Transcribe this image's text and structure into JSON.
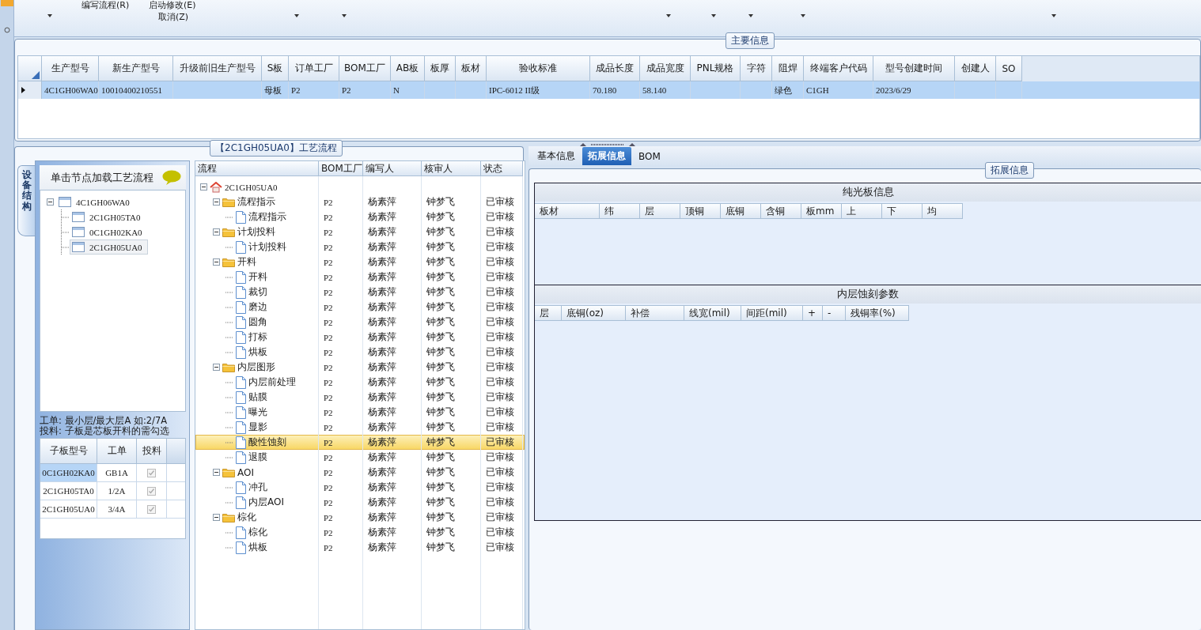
{
  "ribbon": {
    "commands": [
      {
        "label": "编写流程(R)"
      },
      {
        "label": "启动修改(E)"
      },
      {
        "label": "取消(Z)"
      }
    ]
  },
  "main_info": {
    "title": "主要信息",
    "columns": [
      "生产型号",
      "新生产型号",
      "升级前旧生产型号",
      "S板",
      "订单工厂",
      "BOM工厂",
      "AB板",
      "板厚",
      "板材",
      "验收标准",
      "成品长度",
      "成品宽度",
      "PNL规格",
      "字符",
      "阻焊",
      "终端客户代码",
      "型号创建时间",
      "创建人",
      "SO"
    ],
    "rows": [
      {
        "selected": true,
        "cells": [
          "4C1GH06WA0",
          "10010400210551",
          null,
          "母板",
          "P2",
          "P2",
          "N",
          null,
          null,
          "IPC-6012 II级",
          "70.180",
          "58.140",
          null,
          null,
          "绿色",
          "C1GH",
          "2023/6/29",
          null,
          null
        ]
      }
    ]
  },
  "flow_group": {
    "title": "【2C1GH05UA0】工艺流程",
    "side_tab": {
      "label": "设备结构",
      "selected": true
    },
    "structure": {
      "hint": "单击节点加载工艺流程",
      "tree": [
        {
          "label": "4C1GH06WA0",
          "expanded": true,
          "selected": false,
          "children": [
            {
              "label": "2C1GH05TA0",
              "selected": false
            },
            {
              "label": "0C1GH02KA0",
              "selected": false
            },
            {
              "label": "2C1GH05UA0",
              "selected": true
            }
          ]
        }
      ],
      "notes": [
        "工单: 最小层/最大层A 如:2/7A",
        "投料: 子板是芯板开料的需勾选"
      ],
      "sub_boards": {
        "columns": [
          "子板型号",
          "工单",
          "投料"
        ],
        "rows": [
          {
            "model": "0C1GH02KA0",
            "order": "GB1A",
            "feed": true,
            "selected": true
          },
          {
            "model": "2C1GH05TA0",
            "order": "1/2A",
            "feed": true,
            "selected": false
          },
          {
            "model": "2C1GH05UA0",
            "order": "3/4A",
            "feed": true,
            "selected": false
          }
        ]
      }
    },
    "flow": {
      "columns": [
        "流程",
        "BOM工厂",
        "编写人",
        "核审人",
        "状态"
      ],
      "tree": [
        {
          "kind": "root",
          "label": "2C1GH05UA0",
          "expanded": true,
          "selected": false,
          "children": [
            {
              "kind": "folder",
              "label": "流程指示",
              "bom": "P2",
              "writer": "杨素萍",
              "reviewer": "钟梦飞",
              "status": "已审核",
              "expanded": true,
              "selected": false,
              "children": [
                {
                  "kind": "doc",
                  "label": "流程指示",
                  "bom": "P2",
                  "writer": "杨素萍",
                  "reviewer": "钟梦飞",
                  "status": "已审核",
                  "selected": false
                }
              ]
            },
            {
              "kind": "folder",
              "label": "计划投料",
              "bom": "P2",
              "writer": "杨素萍",
              "reviewer": "钟梦飞",
              "status": "已审核",
              "expanded": true,
              "selected": false,
              "children": [
                {
                  "kind": "doc",
                  "label": "计划投料",
                  "bom": "P2",
                  "writer": "杨素萍",
                  "reviewer": "钟梦飞",
                  "status": "已审核",
                  "selected": false
                }
              ]
            },
            {
              "kind": "folder",
              "label": "开料",
              "bom": "P2",
              "writer": "杨素萍",
              "reviewer": "钟梦飞",
              "status": "已审核",
              "expanded": true,
              "selected": false,
              "children": [
                {
                  "kind": "doc",
                  "label": "开料",
                  "bom": "P2",
                  "writer": "杨素萍",
                  "reviewer": "钟梦飞",
                  "status": "已审核",
                  "selected": false
                },
                {
                  "kind": "doc",
                  "label": "裁切",
                  "bom": "P2",
                  "writer": "杨素萍",
                  "reviewer": "钟梦飞",
                  "status": "已审核",
                  "selected": false
                },
                {
                  "kind": "doc",
                  "label": "磨边",
                  "bom": "P2",
                  "writer": "杨素萍",
                  "reviewer": "钟梦飞",
                  "status": "已审核",
                  "selected": false
                },
                {
                  "kind": "doc",
                  "label": "圆角",
                  "bom": "P2",
                  "writer": "杨素萍",
                  "reviewer": "钟梦飞",
                  "status": "已审核",
                  "selected": false
                },
                {
                  "kind": "doc",
                  "label": "打标",
                  "bom": "P2",
                  "writer": "杨素萍",
                  "reviewer": "钟梦飞",
                  "status": "已审核",
                  "selected": false
                },
                {
                  "kind": "doc",
                  "label": "烘板",
                  "bom": "P2",
                  "writer": "杨素萍",
                  "reviewer": "钟梦飞",
                  "status": "已审核",
                  "selected": false
                }
              ]
            },
            {
              "kind": "folder",
              "label": "内层图形",
              "bom": "P2",
              "writer": "杨素萍",
              "reviewer": "钟梦飞",
              "status": "已审核",
              "expanded": true,
              "selected": false,
              "children": [
                {
                  "kind": "doc",
                  "label": "内层前处理",
                  "bom": "P2",
                  "writer": "杨素萍",
                  "reviewer": "钟梦飞",
                  "status": "已审核",
                  "selected": false
                },
                {
                  "kind": "doc",
                  "label": "贴膜",
                  "bom": "P2",
                  "writer": "杨素萍",
                  "reviewer": "钟梦飞",
                  "status": "已审核",
                  "selected": false
                },
                {
                  "kind": "doc",
                  "label": "曝光",
                  "bom": "P2",
                  "writer": "杨素萍",
                  "reviewer": "钟梦飞",
                  "status": "已审核",
                  "selected": false
                },
                {
                  "kind": "doc",
                  "label": "显影",
                  "bom": "P2",
                  "writer": "杨素萍",
                  "reviewer": "钟梦飞",
                  "status": "已审核",
                  "selected": false
                },
                {
                  "kind": "doc",
                  "label": "酸性蚀刻",
                  "bom": "P2",
                  "writer": "杨素萍",
                  "reviewer": "钟梦飞",
                  "status": "已审核",
                  "selected": true
                },
                {
                  "kind": "doc",
                  "label": "退膜",
                  "bom": "P2",
                  "writer": "杨素萍",
                  "reviewer": "钟梦飞",
                  "status": "已审核",
                  "selected": false
                }
              ]
            },
            {
              "kind": "folder",
              "label": "AOI",
              "bom": "P2",
              "writer": "杨素萍",
              "reviewer": "钟梦飞",
              "status": "已审核",
              "expanded": true,
              "selected": false,
              "children": [
                {
                  "kind": "doc",
                  "label": "冲孔",
                  "bom": "P2",
                  "writer": "杨素萍",
                  "reviewer": "钟梦飞",
                  "status": "已审核",
                  "selected": false
                },
                {
                  "kind": "doc",
                  "label": "内层AOI",
                  "bom": "P2",
                  "writer": "杨素萍",
                  "reviewer": "钟梦飞",
                  "status": "已审核",
                  "selected": false
                }
              ]
            },
            {
              "kind": "folder",
              "label": "棕化",
              "bom": "P2",
              "writer": "杨素萍",
              "reviewer": "钟梦飞",
              "status": "已审核",
              "expanded": true,
              "selected": false,
              "children": [
                {
                  "kind": "doc",
                  "label": "棕化",
                  "bom": "P2",
                  "writer": "杨素萍",
                  "reviewer": "钟梦飞",
                  "status": "已审核",
                  "selected": false
                },
                {
                  "kind": "doc",
                  "label": "烘板",
                  "bom": "P2",
                  "writer": "杨素萍",
                  "reviewer": "钟梦飞",
                  "status": "已审核",
                  "selected": false
                }
              ]
            }
          ]
        }
      ]
    }
  },
  "detail": {
    "tabs": [
      {
        "label": "基本信息",
        "selected": false
      },
      {
        "label": "拓展信息",
        "selected": true
      },
      {
        "label": "BOM",
        "selected": false
      }
    ],
    "title": "拓展信息",
    "sections": [
      {
        "title": "纯光板信息",
        "columns": [
          "板材",
          "纬",
          "层",
          "顶铜",
          "底铜",
          "含铜",
          "板mm",
          "上",
          "下",
          "均"
        ]
      },
      {
        "title": "内层蚀刻参数",
        "columns": [
          "层",
          "底铜(oz)",
          "补偿",
          "线宽(mil)",
          "间距(mil)",
          "+",
          "-",
          "残铜率(%)"
        ]
      }
    ]
  }
}
